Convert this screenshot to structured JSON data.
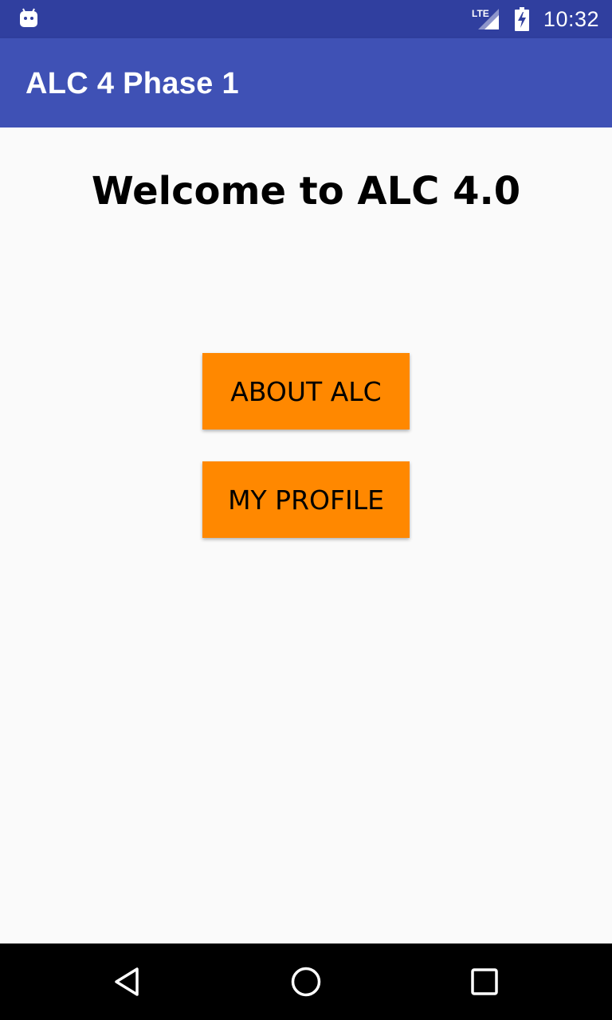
{
  "status_bar": {
    "time": "10:32",
    "network": "LTE",
    "icons": [
      "android-notification-icon",
      "lte-signal-icon",
      "battery-charging-icon"
    ]
  },
  "app_bar": {
    "title": "ALC 4 Phase 1"
  },
  "main": {
    "welcome_text": "Welcome to ALC 4.0",
    "buttons": [
      {
        "label": "ABOUT ALC"
      },
      {
        "label": "MY PROFILE"
      }
    ]
  },
  "nav_bar": {
    "icons": [
      "back-icon",
      "home-icon",
      "recents-icon"
    ]
  },
  "colors": {
    "status_bar": "#303f9f",
    "app_bar": "#3f51b5",
    "background": "#fafafa",
    "button": "#ff8800",
    "nav_bar": "#000000"
  }
}
